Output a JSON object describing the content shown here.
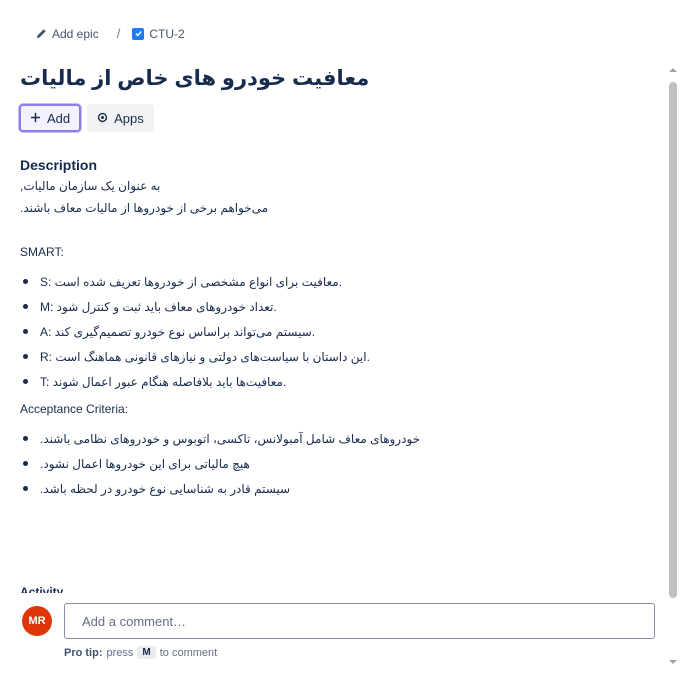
{
  "breadcrumb": {
    "add_epic": "Add epic",
    "separator": "/",
    "issue_key": "CTU-2"
  },
  "issue": {
    "title": "معافیت خودرو های خاص از مالیات"
  },
  "actions": {
    "add_label": "Add",
    "apps_label": "Apps"
  },
  "description": {
    "heading": "Description",
    "intro_lines": [
      ",به عنوان یک سازمان مالیات",
      ".می‌خواهم برخی از خودروها از مالیات معاف باشند"
    ],
    "smart_label": "SMART:",
    "smart_items": [
      "S: معافیت برای انواع مشخصی از خودروها تعریف شده است.",
      "M: تعداد خودروهای معاف باید ثبت و کنترل شود.",
      "A: سیستم می‌تواند براساس نوع خودرو تصمیم‌گیری کند.",
      "R: این داستان با سیاست‌های دولتی و نیازهای قانونی هماهنگ است.",
      "T: معافیت‌ها باید بلافاصله هنگام عبور اعمال شوند."
    ],
    "acceptance_label": "Acceptance Criteria:",
    "acceptance_items": [
      ".خودروهای معاف شامل آمبولانس، تاکسی، اتوبوس و خودروهای نظامی باشند",
      ".هیچ مالیاتی برای این خودروها اعمال نشود",
      ".سیستم قادر به شناسایی نوع خودرو در لحظه باشد"
    ]
  },
  "activity": {
    "heading": "Activity"
  },
  "comment": {
    "avatar_initials": "MR",
    "placeholder": "Add a comment…",
    "pro_tip_label": "Pro tip:",
    "pro_tip_press": "press",
    "pro_tip_key": "M",
    "pro_tip_suffix": "to comment"
  },
  "colors": {
    "accent": "#1d7afc",
    "avatar": "#de350b",
    "focus_ring": "#8f7ee7"
  }
}
